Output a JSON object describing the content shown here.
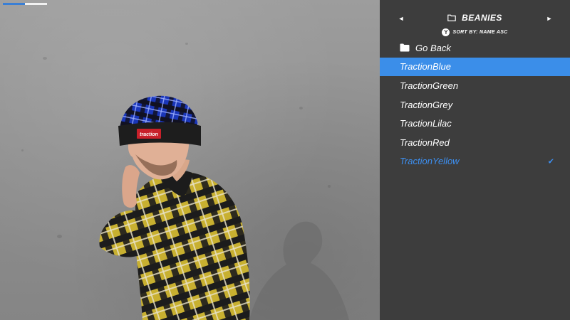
{
  "hud": {
    "progress_fraction": 0.5
  },
  "menu": {
    "title": "BEANIES",
    "prev_arrow": "◄",
    "next_arrow": "►",
    "sort_button": "Y",
    "sort_label": "SORT BY: NAME ASC",
    "go_back_label": "Go Back",
    "items": [
      {
        "label": "TractionBlue",
        "state": "highlighted"
      },
      {
        "label": "TractionGreen",
        "state": "normal"
      },
      {
        "label": "TractionGrey",
        "state": "normal"
      },
      {
        "label": "TractionLilac",
        "state": "normal"
      },
      {
        "label": "TractionRed",
        "state": "normal"
      },
      {
        "label": "TractionYellow",
        "state": "equipped"
      }
    ],
    "equipped_mark": "✔",
    "colors": {
      "panel": "#3d3d3d",
      "highlight": "#3b8ee9",
      "equipped_text": "#3d8ff0"
    }
  },
  "character": {
    "hat_label": "traction"
  }
}
